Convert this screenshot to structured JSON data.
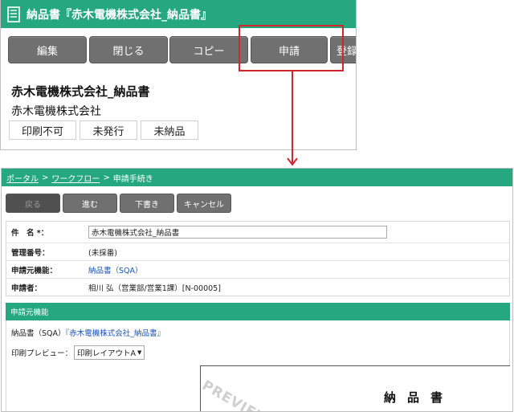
{
  "top_window": {
    "title": "納品書『赤木電機株式会社_納品書』",
    "toolbar": {
      "edit": "編集",
      "close": "閉じる",
      "copy": "コピー",
      "apply": "申請",
      "register_partial": "登録"
    },
    "doc_title": "赤木電機株式会社_納品書",
    "company": "赤木電機株式会社",
    "statuses": [
      "印刷不可",
      "未発行",
      "未納品"
    ]
  },
  "bottom_window": {
    "breadcrumb": {
      "portal": "ポータル",
      "separator": ">",
      "workflow": "ワークフロー",
      "current": "申請手続き"
    },
    "toolbar": {
      "back": "戻る",
      "next": "進む",
      "draft": "下書き",
      "cancel": "キャンセル"
    },
    "form": {
      "subject_label": "件　名 *：",
      "subject_value": "赤木電機株式会社_納品書",
      "mgmt_no_label": "管理番号：",
      "mgmt_no_value": "(未採番)",
      "source_func_label": "申請元機能：",
      "source_func_value": "納品書（SQA）",
      "applicant_label": "申請者：",
      "applicant_value": "相川 弘（営業部/営業1課）[N-00005]"
    },
    "source_section": {
      "header": "申請元機能",
      "source_prefix": "納品書（SQA）",
      "source_link": "『赤木電機株式会社_納品書』",
      "preview_label": "印刷プレビュー：",
      "preview_select": "印刷レイアウトA",
      "preview_stamp": "PREVIEW",
      "paper_title": "納品書"
    }
  },
  "colors": {
    "accent": "#25a77f",
    "button": "#707070",
    "highlight": "#d3252a",
    "link": "#1a55b3"
  }
}
